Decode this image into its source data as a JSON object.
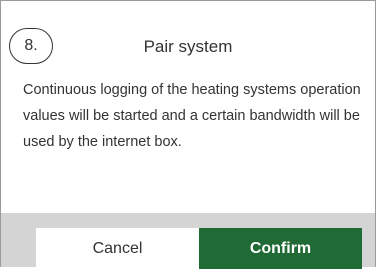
{
  "dialog": {
    "step_number": "8.",
    "title": "Pair system",
    "message": "Continuous logging of the heating systems operation values will be started and a certain bandwidth will be used by the internet box.",
    "cancel_label": "Cancel",
    "confirm_label": "Confirm"
  },
  "colors": {
    "confirm_background": "#1f6a35",
    "footer_background": "#d4d4d4",
    "text": "#333333"
  }
}
